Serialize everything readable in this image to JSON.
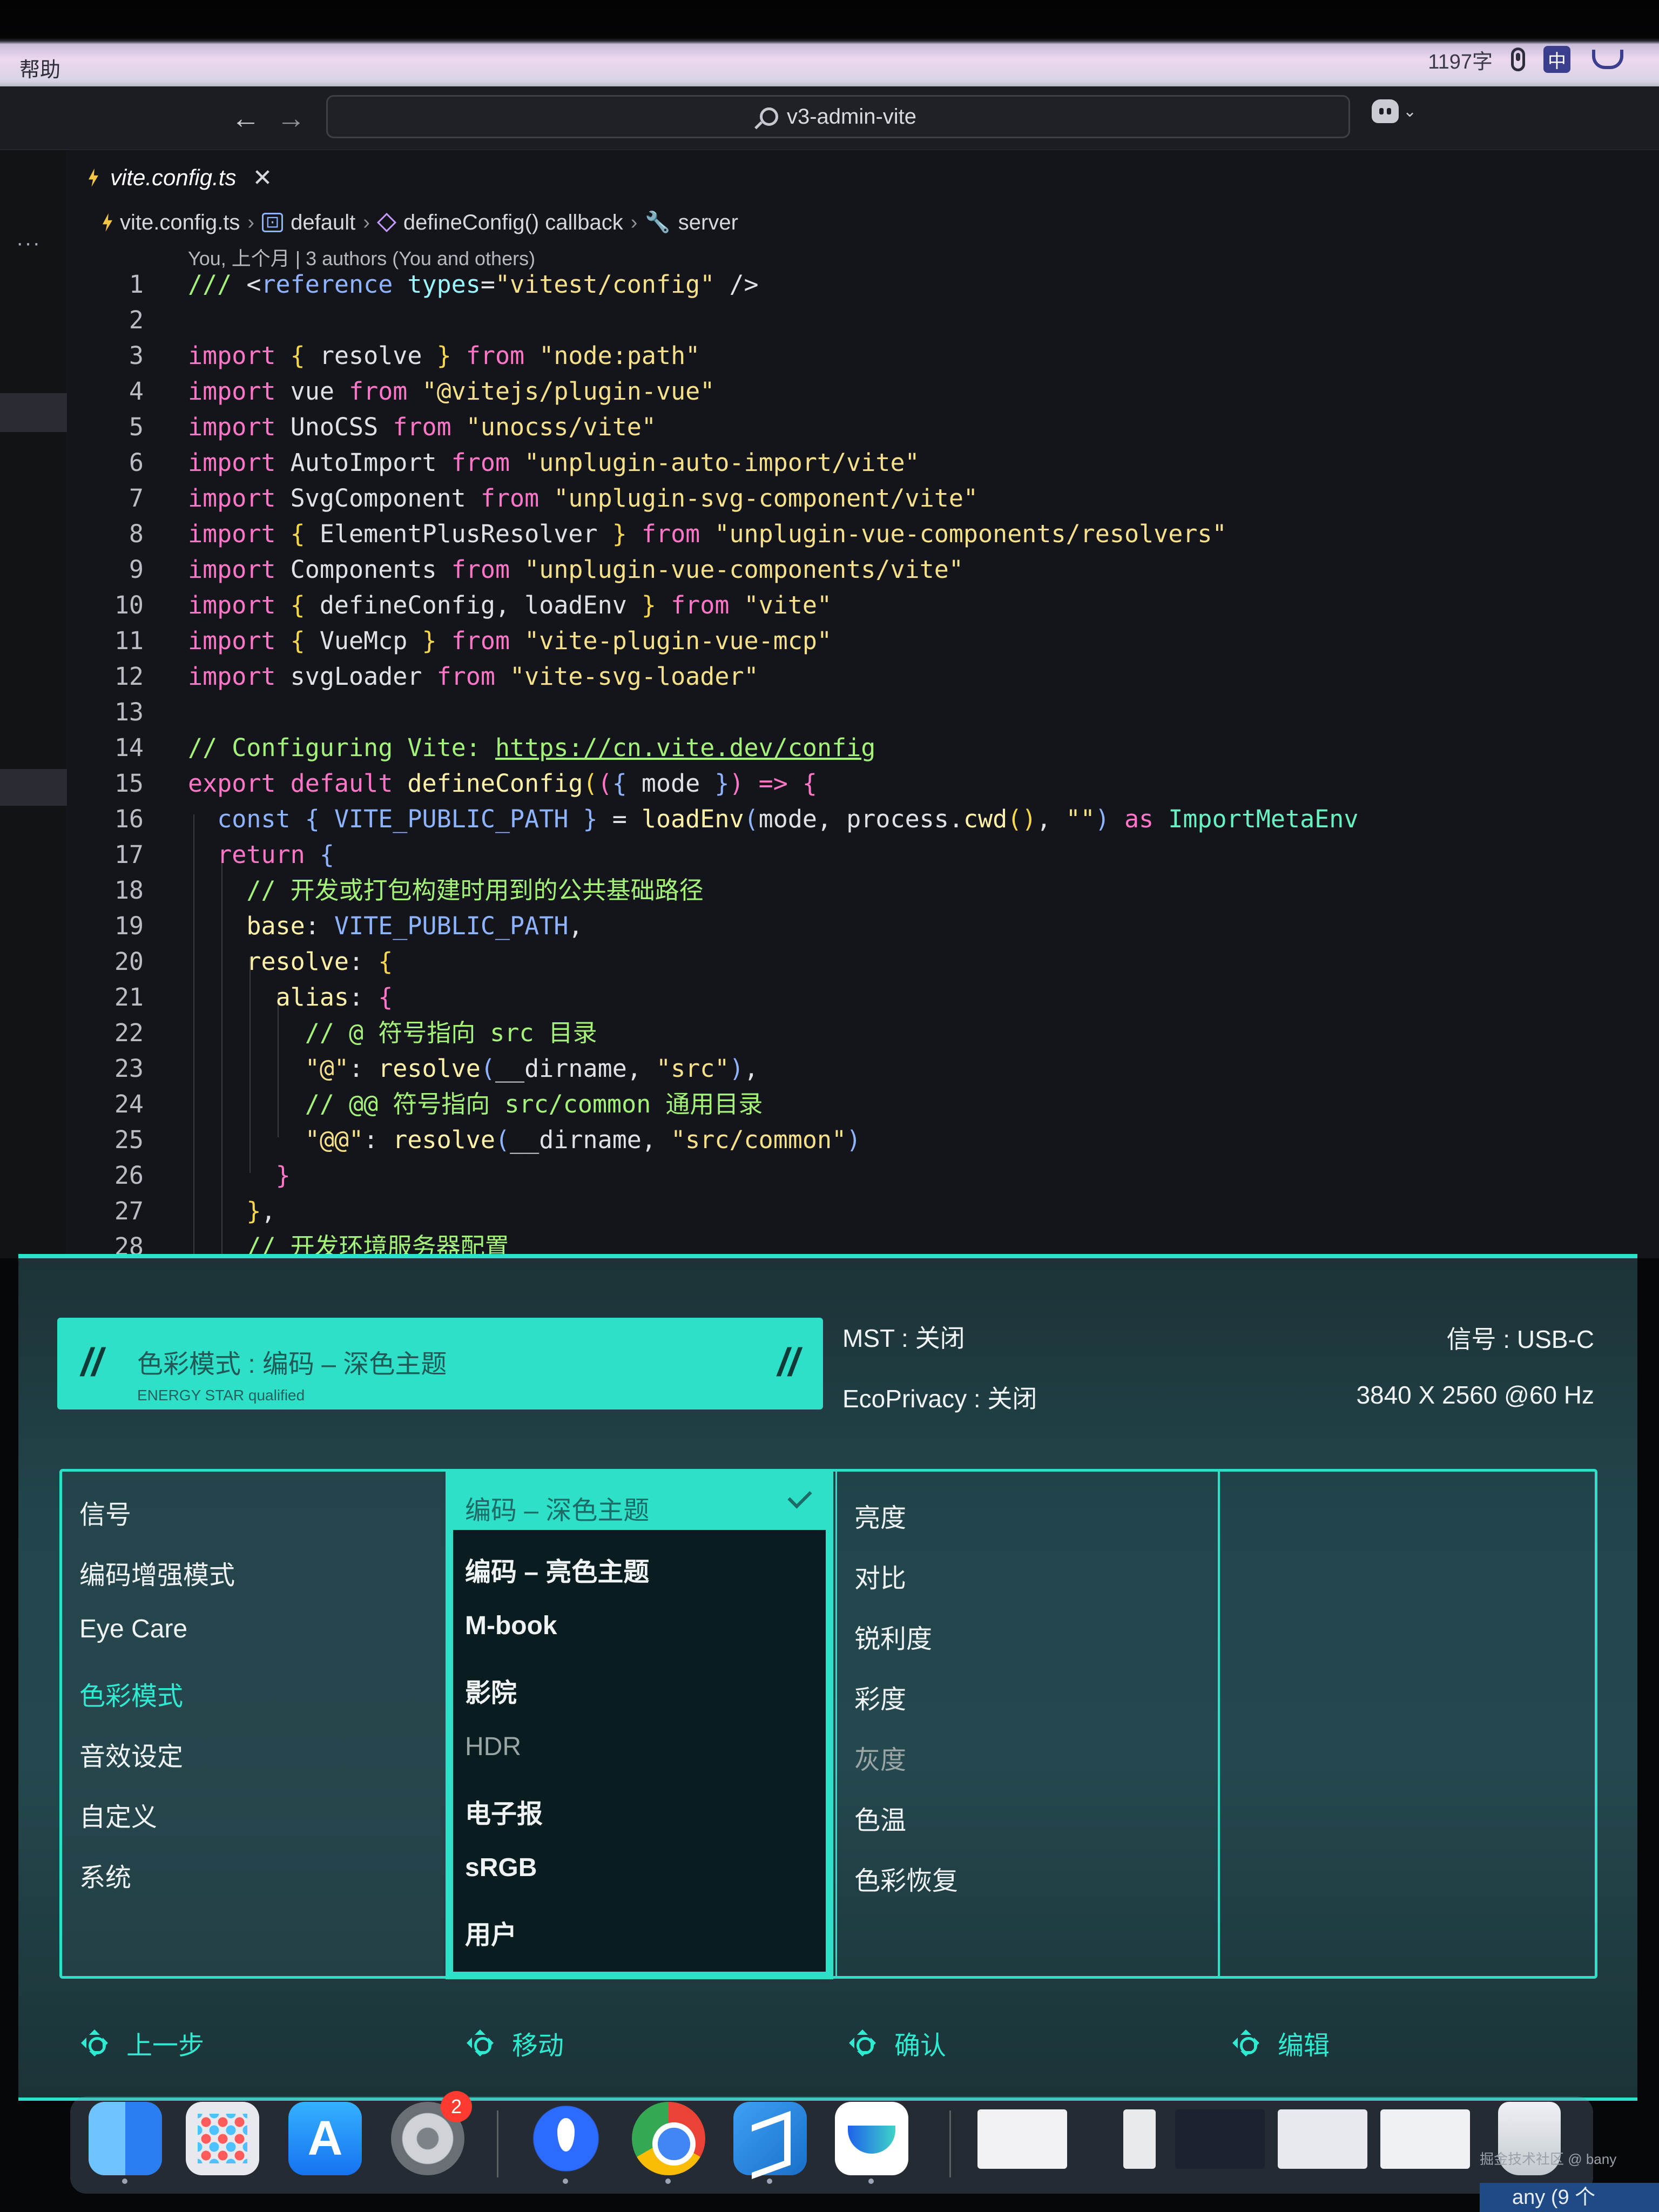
{
  "menubar": {
    "help": "帮助",
    "word_count": "1197字",
    "ime": "中",
    "icons": [
      "mic-icon",
      "ime-badge",
      "tray-icon"
    ]
  },
  "vscode": {
    "search": "v3-admin-vite",
    "nav_back": "←",
    "nav_forward": "→",
    "more": "···",
    "tab": "vite.config.ts",
    "tab_close": "✕",
    "breadcrumb": [
      "vite.config.ts",
      "default",
      "defineConfig() callback",
      "server"
    ],
    "blame": "You, 上个月 | 3 authors (You and others)",
    "code_lines": [
      {
        "n": "1",
        "toks": [
          [
            "cm",
            "/// "
          ],
          [
            "id",
            "<"
          ],
          [
            "kwb",
            "reference "
          ],
          [
            "prop",
            "types"
          ],
          [
            "id",
            "="
          ],
          [
            "str",
            "\"vitest/config\""
          ],
          [
            "id",
            " />"
          ]
        ]
      },
      {
        "n": "2",
        "toks": []
      },
      {
        "n": "3",
        "toks": [
          [
            "kw",
            "import "
          ],
          [
            "brace",
            "{ "
          ],
          [
            "id",
            "resolve "
          ],
          [
            "brace",
            "} "
          ],
          [
            "kw",
            "from "
          ],
          [
            "str",
            "\"node:path\""
          ]
        ]
      },
      {
        "n": "4",
        "toks": [
          [
            "kw",
            "import "
          ],
          [
            "id",
            "vue "
          ],
          [
            "kw",
            "from "
          ],
          [
            "str",
            "\"@vitejs/plugin-vue\""
          ]
        ]
      },
      {
        "n": "5",
        "toks": [
          [
            "kw",
            "import "
          ],
          [
            "id",
            "UnoCSS "
          ],
          [
            "kw",
            "from "
          ],
          [
            "str",
            "\"unocss/vite\""
          ]
        ]
      },
      {
        "n": "6",
        "toks": [
          [
            "kw",
            "import "
          ],
          [
            "id",
            "AutoImport "
          ],
          [
            "kw",
            "from "
          ],
          [
            "str",
            "\"unplugin-auto-import/vite\""
          ]
        ]
      },
      {
        "n": "7",
        "toks": [
          [
            "kw",
            "import "
          ],
          [
            "id",
            "SvgComponent "
          ],
          [
            "kw",
            "from "
          ],
          [
            "str",
            "\"unplugin-svg-component/vite\""
          ]
        ]
      },
      {
        "n": "8",
        "toks": [
          [
            "kw",
            "import "
          ],
          [
            "brace",
            "{ "
          ],
          [
            "id",
            "ElementPlusResolver "
          ],
          [
            "brace",
            "} "
          ],
          [
            "kw",
            "from "
          ],
          [
            "str",
            "\"unplugin-vue-components/resolvers\""
          ]
        ]
      },
      {
        "n": "9",
        "toks": [
          [
            "kw",
            "import "
          ],
          [
            "id",
            "Components "
          ],
          [
            "kw",
            "from "
          ],
          [
            "str",
            "\"unplugin-vue-components/vite\""
          ]
        ]
      },
      {
        "n": "10",
        "toks": [
          [
            "kw",
            "import "
          ],
          [
            "brace",
            "{ "
          ],
          [
            "id",
            "defineConfig, loadEnv "
          ],
          [
            "brace",
            "} "
          ],
          [
            "kw",
            "from "
          ],
          [
            "str",
            "\"vite\""
          ]
        ]
      },
      {
        "n": "11",
        "toks": [
          [
            "kw",
            "import "
          ],
          [
            "brace",
            "{ "
          ],
          [
            "id",
            "VueMcp "
          ],
          [
            "brace",
            "} "
          ],
          [
            "kw",
            "from "
          ],
          [
            "str",
            "\"vite-plugin-vue-mcp\""
          ]
        ]
      },
      {
        "n": "12",
        "toks": [
          [
            "kw",
            "import "
          ],
          [
            "id",
            "svgLoader "
          ],
          [
            "kw",
            "from "
          ],
          [
            "str",
            "\"vite-svg-loader\""
          ]
        ]
      },
      {
        "n": "13",
        "toks": []
      },
      {
        "n": "14",
        "toks": [
          [
            "cm",
            "// Configuring Vite: "
          ],
          [
            "url",
            "https://cn.vite.dev/config"
          ]
        ]
      },
      {
        "n": "15",
        "toks": [
          [
            "kw",
            "export default "
          ],
          [
            "fn",
            "defineConfig"
          ],
          [
            "brace",
            "("
          ],
          [
            "paren",
            "("
          ],
          [
            "kwb",
            "{ "
          ],
          [
            "id",
            "mode "
          ],
          [
            "kwb",
            "}"
          ],
          [
            "paren",
            ")"
          ],
          [
            "kw",
            " => "
          ],
          [
            "paren",
            "{"
          ]
        ]
      },
      {
        "n": "16",
        "toks": [
          [
            "id",
            "  "
          ],
          [
            "kwb",
            "const "
          ],
          [
            "kwb",
            "{ "
          ],
          [
            "const",
            "VITE_PUBLIC_PATH "
          ],
          [
            "kwb",
            "} "
          ],
          [
            "id",
            "= "
          ],
          [
            "fn",
            "loadEnv"
          ],
          [
            "kwb",
            "("
          ],
          [
            "id",
            "mode, process."
          ],
          [
            "fn",
            "cwd"
          ],
          [
            "brace",
            "()"
          ],
          [
            "id",
            ", "
          ],
          [
            "str",
            "\"\""
          ],
          [
            "kwb",
            ")"
          ],
          [
            "kw",
            " as "
          ],
          [
            "type",
            "ImportMetaEnv"
          ]
        ]
      },
      {
        "n": "17",
        "toks": [
          [
            "id",
            "  "
          ],
          [
            "kw",
            "return "
          ],
          [
            "kwb",
            "{"
          ]
        ]
      },
      {
        "n": "18",
        "toks": [
          [
            "id",
            "    "
          ],
          [
            "cm",
            "// 开发或打包构建时用到的公共基础路径"
          ]
        ]
      },
      {
        "n": "19",
        "toks": [
          [
            "id",
            "    "
          ],
          [
            "fn",
            "base"
          ],
          [
            "id",
            ": "
          ],
          [
            "const",
            "VITE_PUBLIC_PATH"
          ],
          [
            "id",
            ","
          ]
        ]
      },
      {
        "n": "20",
        "toks": [
          [
            "id",
            "    "
          ],
          [
            "fn",
            "resolve"
          ],
          [
            "id",
            ": "
          ],
          [
            "brace",
            "{"
          ]
        ]
      },
      {
        "n": "21",
        "toks": [
          [
            "id",
            "      "
          ],
          [
            "fn",
            "alias"
          ],
          [
            "id",
            ": "
          ],
          [
            "paren",
            "{"
          ]
        ]
      },
      {
        "n": "22",
        "toks": [
          [
            "id",
            "        "
          ],
          [
            "cm",
            "// @ 符号指向 src 目录"
          ]
        ]
      },
      {
        "n": "23",
        "toks": [
          [
            "id",
            "        "
          ],
          [
            "str",
            "\"@\""
          ],
          [
            "id",
            ": "
          ],
          [
            "fn",
            "resolve"
          ],
          [
            "kwb",
            "("
          ],
          [
            "id",
            "__dirname, "
          ],
          [
            "str",
            "\"src\""
          ],
          [
            "kwb",
            ")"
          ],
          [
            "id",
            ","
          ]
        ]
      },
      {
        "n": "24",
        "toks": [
          [
            "id",
            "        "
          ],
          [
            "cm",
            "// @@ 符号指向 src/common 通用目录"
          ]
        ]
      },
      {
        "n": "25",
        "toks": [
          [
            "id",
            "        "
          ],
          [
            "str",
            "\"@@\""
          ],
          [
            "id",
            ": "
          ],
          [
            "fn",
            "resolve"
          ],
          [
            "kwb",
            "("
          ],
          [
            "id",
            "__dirname, "
          ],
          [
            "str",
            "\"src/common\""
          ],
          [
            "kwb",
            ")"
          ]
        ]
      },
      {
        "n": "26",
        "toks": [
          [
            "id",
            "      "
          ],
          [
            "paren",
            "}"
          ]
        ]
      },
      {
        "n": "27",
        "toks": [
          [
            "id",
            "    "
          ],
          [
            "brace",
            "}"
          ],
          [
            "id",
            ","
          ]
        ]
      },
      {
        "n": "28",
        "toks": [
          [
            "id",
            "    "
          ],
          [
            "cm",
            "// 开发环境服务器配置"
          ]
        ]
      }
    ]
  },
  "osd": {
    "mode_title": "色彩模式 : 编码 – 深色主题",
    "mode_sub": "ENERGY STAR qualified",
    "mst": "MST : 关闭",
    "ecoprivacy": "EcoPrivacy : 关闭",
    "signal": "信号 : USB-C",
    "resolution": "3840 X 2560 @60 Hz",
    "menu": [
      "信号",
      "编码增强模式",
      "Eye Care",
      "色彩模式",
      "音效设定",
      "自定义",
      "系统"
    ],
    "menu_active_index": 3,
    "modes": [
      "编码 – 深色主题",
      "编码 – 亮色主题",
      "M-book",
      "影院",
      "HDR",
      "电子报",
      "sRGB",
      "用户"
    ],
    "modes_selected_index": 0,
    "modes_dim_index": 4,
    "settings": [
      "亮度",
      "对比",
      "锐利度",
      "彩度",
      "灰度",
      "色温",
      "色彩恢复"
    ],
    "settings_dim_index": 4,
    "footer": {
      "back": "上一步",
      "move": "移动",
      "confirm": "确认",
      "edit": "编辑"
    }
  },
  "dock": {
    "settings_badge": "2",
    "watermark": "掘金技术社区 @ bany",
    "status": "any (9 个",
    "apps": [
      "finder",
      "launchpad",
      "app-store",
      "system-settings",
      "maps",
      "chrome",
      "vscode",
      "feishu",
      "trash"
    ]
  }
}
